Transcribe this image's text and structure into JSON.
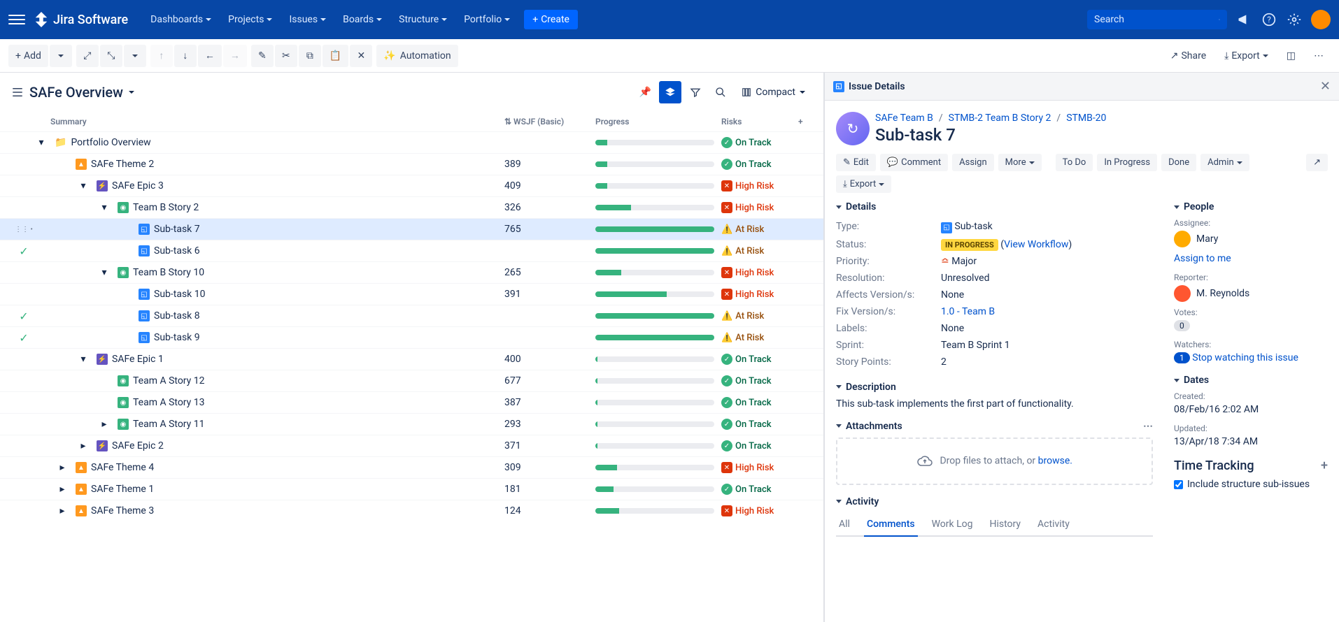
{
  "topbar": {
    "logo": "Jira Software",
    "nav": [
      "Dashboards",
      "Projects",
      "Issues",
      "Boards",
      "Structure",
      "Portfolio"
    ],
    "create": "Create",
    "search_placeholder": "Search"
  },
  "toolbar": {
    "add": "Add",
    "automation": "Automation",
    "share": "Share",
    "export": "Export"
  },
  "structure": {
    "title": "SAFe Overview",
    "view_mode": "Compact",
    "columns": {
      "summary": "Summary",
      "wsjf": "WSJF (Basic)",
      "progress": "Progress",
      "risk": "Risks"
    },
    "rows": [
      {
        "indent": 0,
        "type": "folder",
        "text": "Portfolio Overview",
        "wsjf": "",
        "progress": 10,
        "risk": "on-track",
        "expand": "open"
      },
      {
        "indent": 1,
        "type": "theme",
        "text": "SAFe Theme 2",
        "wsjf": "389",
        "progress": 10,
        "risk": "on-track",
        "expand": "none"
      },
      {
        "indent": 2,
        "type": "epic",
        "text": "SAFe Epic 3",
        "wsjf": "409",
        "progress": 10,
        "risk": "high",
        "expand": "open"
      },
      {
        "indent": 3,
        "type": "story",
        "text": "Team B Story 2",
        "wsjf": "326",
        "progress": 30,
        "risk": "high",
        "expand": "open"
      },
      {
        "indent": 4,
        "type": "subtask",
        "text": "Sub-task 7",
        "wsjf": "765",
        "progress": 100,
        "risk": "at-risk",
        "selected": true,
        "expand": "none"
      },
      {
        "indent": 4,
        "type": "subtask",
        "text": "Sub-task 6",
        "wsjf": "",
        "progress": 100,
        "risk": "at-risk",
        "check": true,
        "expand": "none"
      },
      {
        "indent": 3,
        "type": "story",
        "text": "Team B Story 10",
        "wsjf": "265",
        "progress": 22,
        "risk": "high",
        "expand": "open"
      },
      {
        "indent": 4,
        "type": "subtask",
        "text": "Sub-task 10",
        "wsjf": "391",
        "progress": 60,
        "risk": "high",
        "expand": "none"
      },
      {
        "indent": 4,
        "type": "subtask",
        "text": "Sub-task 8",
        "wsjf": "",
        "progress": 100,
        "risk": "at-risk",
        "check": true,
        "expand": "none"
      },
      {
        "indent": 4,
        "type": "subtask",
        "text": "Sub-task 9",
        "wsjf": "",
        "progress": 100,
        "risk": "at-risk",
        "check": true,
        "expand": "none"
      },
      {
        "indent": 2,
        "type": "epic",
        "text": "SAFe Epic 1",
        "wsjf": "400",
        "progress": 2,
        "risk": "on-track",
        "expand": "open"
      },
      {
        "indent": 3,
        "type": "story",
        "text": "Team A Story 12",
        "wsjf": "677",
        "progress": 2,
        "risk": "on-track",
        "expand": "none"
      },
      {
        "indent": 3,
        "type": "story",
        "text": "Team A Story 13",
        "wsjf": "387",
        "progress": 2,
        "risk": "on-track",
        "expand": "none"
      },
      {
        "indent": 3,
        "type": "story",
        "text": "Team A Story 11",
        "wsjf": "293",
        "progress": 2,
        "risk": "on-track",
        "expand": "closed"
      },
      {
        "indent": 2,
        "type": "epic",
        "text": "SAFe Epic 2",
        "wsjf": "371",
        "progress": 2,
        "risk": "on-track",
        "expand": "closed"
      },
      {
        "indent": 1,
        "type": "theme",
        "text": "SAFe Theme 4",
        "wsjf": "309",
        "progress": 18,
        "risk": "high",
        "expand": "closed"
      },
      {
        "indent": 1,
        "type": "theme",
        "text": "SAFe Theme 1",
        "wsjf": "181",
        "progress": 15,
        "risk": "on-track",
        "expand": "closed"
      },
      {
        "indent": 1,
        "type": "theme",
        "text": "SAFe Theme 3",
        "wsjf": "124",
        "progress": 20,
        "risk": "high",
        "expand": "closed"
      }
    ],
    "risk_labels": {
      "on-track": "On Track",
      "high": "High Risk",
      "at-risk": "At Risk"
    }
  },
  "details": {
    "panel_title": "Issue Details",
    "breadcrumb": [
      "SAFe Team B",
      "STMB-2 Team B Story 2",
      "STMB-20"
    ],
    "title": "Sub-task 7",
    "actions": {
      "edit": "Edit",
      "comment": "Comment",
      "assign": "Assign",
      "more": "More",
      "todo": "To Do",
      "in_progress": "In Progress",
      "done": "Done",
      "admin": "Admin",
      "export": "Export"
    },
    "sections": {
      "details": "Details",
      "description": "Description",
      "attachments": "Attachments",
      "activity": "Activity",
      "people": "People",
      "dates": "Dates",
      "time_tracking": "Time Tracking"
    },
    "fields": {
      "type_label": "Type:",
      "type_value": "Sub-task",
      "status_label": "Status:",
      "status_value": "IN PROGRESS",
      "status_link": "View Workflow",
      "priority_label": "Priority:",
      "priority_value": "Major",
      "resolution_label": "Resolution:",
      "resolution_value": "Unresolved",
      "affects_label": "Affects Version/s:",
      "affects_value": "None",
      "fix_label": "Fix Version/s:",
      "fix_value": "1.0 - Team B",
      "labels_label": "Labels:",
      "labels_value": "None",
      "sprint_label": "Sprint:",
      "sprint_value": "Team B Sprint 1",
      "sp_label": "Story Points:",
      "sp_value": "2"
    },
    "description_text": "This sub-task implements the first part of functionality.",
    "attach_text": "Drop files to attach, or ",
    "attach_link": "browse.",
    "tabs": [
      "All",
      "Comments",
      "Work Log",
      "History",
      "Activity"
    ],
    "active_tab": "Comments",
    "people": {
      "assignee_label": "Assignee:",
      "assignee_name": "Mary",
      "assign_to_me": "Assign to me",
      "reporter_label": "Reporter:",
      "reporter_name": "M. Reynolds",
      "votes_label": "Votes:",
      "votes_count": "0",
      "watchers_label": "Watchers:",
      "watchers_count": "1",
      "stop_watching": "Stop watching this issue"
    },
    "dates": {
      "created_label": "Created:",
      "created_value": "08/Feb/16 2:02 AM",
      "updated_label": "Updated:",
      "updated_value": "13/Apr/18 7:34 AM"
    },
    "time_tracking_check": "Include structure sub-issues"
  }
}
